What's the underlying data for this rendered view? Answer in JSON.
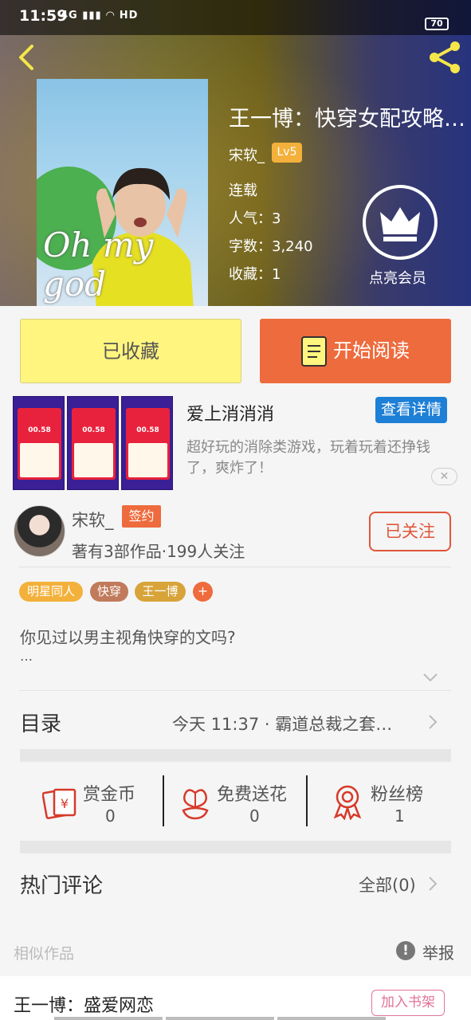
{
  "status_bar": {
    "time": "11:59",
    "signal": "4G",
    "network": "HD",
    "battery": "70"
  },
  "book": {
    "title": "王一博：快穿女配攻略…",
    "cover_caption": "Oh my god",
    "author": "宋软_",
    "author_level": "Lv5",
    "status": "连载",
    "popularity": "人气：3",
    "word_count": "字数：3,240",
    "favorites": "收藏：1"
  },
  "vip": {
    "label": "点亮会员"
  },
  "actions": {
    "favorited_label": "已收藏",
    "read_label": "开始阅读"
  },
  "ad": {
    "screenshot_amount": "00.58",
    "title": "爱上消消消",
    "button": "查看详情",
    "description": "超好玩的消除类游戏，玩着玩着还挣钱了，爽炸了！",
    "close": "✕"
  },
  "author_card": {
    "name": "宋软_",
    "badge": "签约",
    "stats": "著有3部作品·199人关注",
    "follow_label": "已关注"
  },
  "tags": [
    {
      "label": "明星同人",
      "color": "#f3b13b"
    },
    {
      "label": "快穿",
      "color": "#c17a5b"
    },
    {
      "label": "王一博",
      "color": "#d8a43a"
    }
  ],
  "tag_add": "+",
  "intro": {
    "text": "你见过以男主视角快穿的文吗?",
    "more": "…"
  },
  "toc": {
    "label": "目录",
    "latest": "今天 11:37 · 霸道总裁之套…"
  },
  "stats": [
    {
      "label": "赏金币",
      "value": "0"
    },
    {
      "label": "免费送花",
      "value": "0"
    },
    {
      "label": "粉丝榜",
      "value": "1"
    }
  ],
  "comments": {
    "label": "热门评论",
    "all": "全部(0)"
  },
  "similar": {
    "label": "相似作品",
    "report": "举报",
    "report_icon": "!"
  },
  "similar_item": {
    "title": "王一博：盛爱网恋",
    "button": "加入书架"
  },
  "colors": {
    "accent": "#ee6b3d",
    "favorite": "#fff57f",
    "ad_button": "#1e7fd6"
  }
}
